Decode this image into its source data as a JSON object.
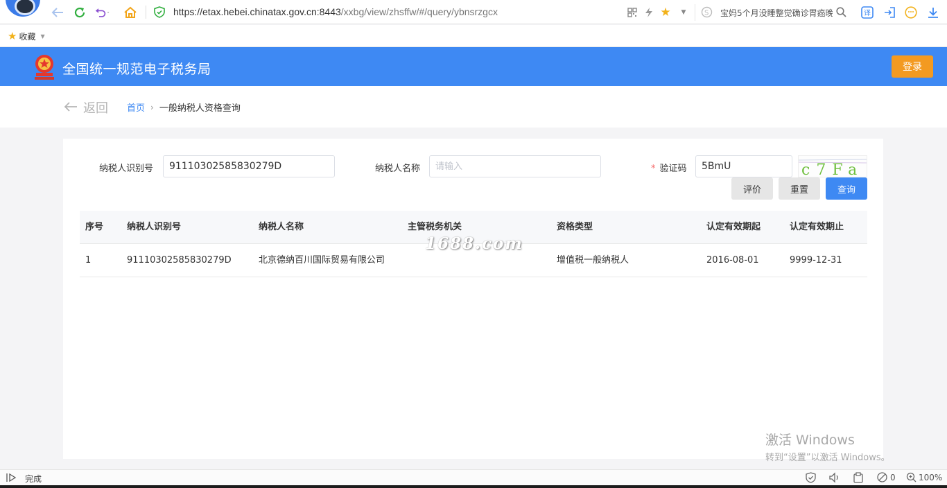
{
  "browser": {
    "url_host": "https://etax.hebei.chinatax.gov.cn:8443",
    "url_path": "/xxbg/view/zhsffw/#/query/ybnsrzgcx",
    "search_hint": "宝妈5个月没睡整觉确诊胃癌晚",
    "bookmark_label": "收藏"
  },
  "site": {
    "title": "全国统一规范电子税务局",
    "login_label": "登录"
  },
  "breadcrumb": {
    "back_label": "返回",
    "home": "首页",
    "separator": "›",
    "current": "一般纳税人资格查询"
  },
  "form": {
    "taxpayer_id_label": "纳税人识别号",
    "taxpayer_id_value": "91110302585830279D",
    "taxpayer_name_label": "纳税人名称",
    "taxpayer_name_placeholder": "请输入",
    "captcha_required_mark": "*",
    "captcha_label": "验证码",
    "captcha_value": "5BmU",
    "captcha_image_text": "c7Fa",
    "evaluate_label": "评价",
    "reset_label": "重置",
    "query_label": "查询"
  },
  "table": {
    "headers": [
      "序号",
      "纳税人识别号",
      "纳税人名称",
      "主管税务机关",
      "资格类型",
      "认定有效期起",
      "认定有效期止"
    ],
    "rows": [
      [
        "1",
        "91110302585830279D",
        "北京德纳百川国际贸易有限公司",
        "",
        "增值税一般纳税人",
        "2016-08-01",
        "9999-12-31"
      ]
    ]
  },
  "overlay": {
    "watermark": "1688.com",
    "windows_line1": "激活 Windows",
    "windows_line2": "转到“设置”以激活 Windows。"
  },
  "status_bar": {
    "status": "完成",
    "block_count": "0",
    "zoom": "100%"
  },
  "colors": {
    "brand_blue": "#3e89f3",
    "login_orange": "#f39a21",
    "required_red": "#f56c6c"
  }
}
